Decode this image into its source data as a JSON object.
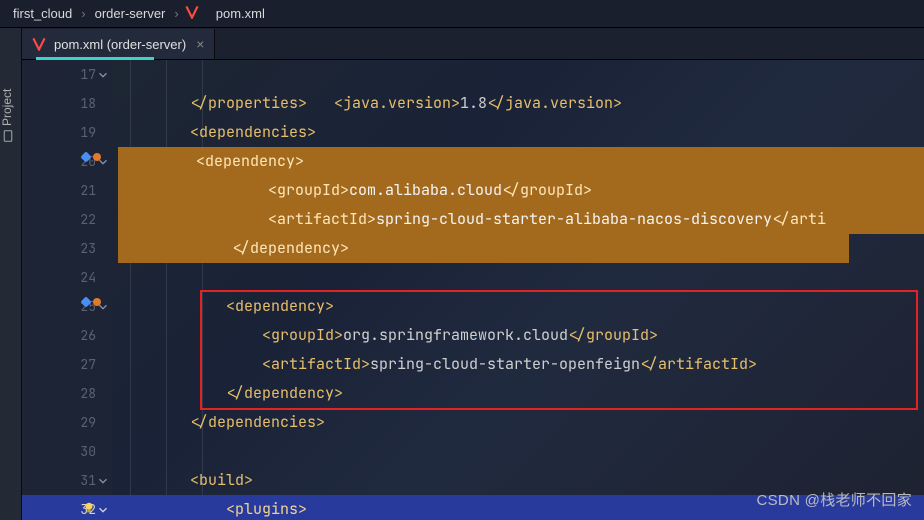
{
  "breadcrumb": {
    "items": [
      "first_cloud",
      "order-server",
      "pom.xml"
    ]
  },
  "rail": {
    "label": "Project"
  },
  "tab": {
    "label": "pom.xml (order-server)",
    "close": "×"
  },
  "gutter": [
    {
      "n": "17",
      "fold": true
    },
    {
      "n": "18"
    },
    {
      "n": "19"
    },
    {
      "n": "20",
      "fold": true,
      "icons": true
    },
    {
      "n": "21"
    },
    {
      "n": "22"
    },
    {
      "n": "23"
    },
    {
      "n": "24"
    },
    {
      "n": "25",
      "fold": true,
      "icons": true
    },
    {
      "n": "26"
    },
    {
      "n": "27"
    },
    {
      "n": "28"
    },
    {
      "n": "29"
    },
    {
      "n": "30"
    },
    {
      "n": "31",
      "fold": true
    },
    {
      "n": "32",
      "fold": true,
      "current": true,
      "bulb": true
    }
  ],
  "code": {
    "l17": {
      "open": "<java.version>",
      "val": "1.8",
      "close": "</java.version>",
      "indent": 4
    },
    "l18": {
      "tag": "</properties>",
      "indent": 2
    },
    "l19": {
      "tag": "<dependencies>",
      "indent": 2
    },
    "l20": {
      "tag": "<dependency>",
      "indent": 3
    },
    "l21": {
      "open": "<groupId>",
      "val": "com.alibaba.cloud",
      "close": "</groupId>",
      "indent": 4
    },
    "l22": {
      "open": "<artifactId>",
      "val": "spring-cloud-starter-alibaba-nacos-discovery",
      "close": "</arti",
      "indent": 4
    },
    "l23": {
      "tag": "</dependency>",
      "indent": 3
    },
    "l24": {
      "blank": ""
    },
    "l25": {
      "tag": "<dependency>",
      "indent": 3
    },
    "l26": {
      "open": "<groupId>",
      "val": "org.springframework.cloud",
      "close": "</groupId>",
      "indent": 4
    },
    "l27": {
      "open": "<artifactId>",
      "val": "spring-cloud-starter-openfeign",
      "close": "</artifactId>",
      "indent": 4
    },
    "l28": {
      "tag": "</dependency>",
      "indent": 3
    },
    "l29": {
      "tag": "</dependencies>",
      "indent": 2
    },
    "l30": {
      "blank": ""
    },
    "l31": {
      "tag": "<build>",
      "indent": 2
    },
    "l32": {
      "tag": "<plugins>",
      "indent": 3
    }
  },
  "watermark": "CSDN @栈老师不回家"
}
